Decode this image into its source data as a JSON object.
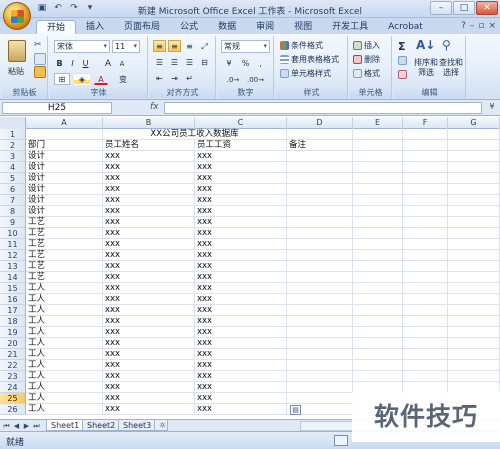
{
  "window": {
    "title": "新建 Microsoft Office Excel 工作表 - Microsoft Excel",
    "controls": [
      "–",
      "□",
      "✕"
    ]
  },
  "ribbon_tabs": [
    "开始",
    "插入",
    "页面布局",
    "公式",
    "数据",
    "审阅",
    "视图",
    "开发工具",
    "Acrobat"
  ],
  "ribbon": {
    "clipboard": {
      "paste": "粘贴",
      "label": "剪贴板"
    },
    "font": {
      "name": "宋体",
      "size": "11",
      "bold": "B",
      "italic": "I",
      "underline": "U",
      "grow": "A",
      "shrink": "A",
      "color_a": "A",
      "phonetic": "变",
      "label": "字体"
    },
    "alignment": {
      "label": "对齐方式"
    },
    "number": {
      "format": "常规",
      "label": "数字"
    },
    "styles": {
      "conditional": "条件格式",
      "table_format": "套用表格格式",
      "cell_styles": "单元格样式",
      "label": "样式"
    },
    "cells": {
      "insert": "插入",
      "delete": "删除",
      "format": "格式",
      "label": "单元格"
    },
    "editing": {
      "sum": "Σ",
      "sort": "排序和\n筛选",
      "find": "查找和\n选择",
      "label": "编辑"
    }
  },
  "formula_bar": {
    "name_box": "H25",
    "fx": "fx",
    "formula": ""
  },
  "columns": [
    "A",
    "B",
    "C",
    "D",
    "E",
    "F",
    "G"
  ],
  "rows": [
    {
      "n": "1",
      "a": "",
      "b": "",
      "c": "XX公司员工收入数据库",
      "d": ""
    },
    {
      "n": "2",
      "a": "部门",
      "b": "员工姓名",
      "c": "员工工资",
      "d": "备注"
    },
    {
      "n": "3",
      "a": "设计",
      "b": "xxx",
      "c": "xxx",
      "d": ""
    },
    {
      "n": "4",
      "a": "设计",
      "b": "xxx",
      "c": "xxx",
      "d": ""
    },
    {
      "n": "5",
      "a": "设计",
      "b": "xxx",
      "c": "xxx",
      "d": ""
    },
    {
      "n": "6",
      "a": "设计",
      "b": "xxx",
      "c": "xxx",
      "d": ""
    },
    {
      "n": "7",
      "a": "设计",
      "b": "xxx",
      "c": "xxx",
      "d": ""
    },
    {
      "n": "8",
      "a": "设计",
      "b": "xxx",
      "c": "xxx",
      "d": ""
    },
    {
      "n": "9",
      "a": "工艺",
      "b": "xxx",
      "c": "xxx",
      "d": ""
    },
    {
      "n": "10",
      "a": "工艺",
      "b": "xxx",
      "c": "xxx",
      "d": ""
    },
    {
      "n": "11",
      "a": "工艺",
      "b": "xxx",
      "c": "xxx",
      "d": ""
    },
    {
      "n": "12",
      "a": "工艺",
      "b": "xxx",
      "c": "xxx",
      "d": ""
    },
    {
      "n": "13",
      "a": "工艺",
      "b": "xxx",
      "c": "xxx",
      "d": ""
    },
    {
      "n": "14",
      "a": "工艺",
      "b": "xxx",
      "c": "xxx",
      "d": ""
    },
    {
      "n": "15",
      "a": "工人",
      "b": "xxx",
      "c": "xxx",
      "d": ""
    },
    {
      "n": "16",
      "a": "工人",
      "b": "xxx",
      "c": "xxx",
      "d": ""
    },
    {
      "n": "17",
      "a": "工人",
      "b": "xxx",
      "c": "xxx",
      "d": ""
    },
    {
      "n": "18",
      "a": "工人",
      "b": "xxx",
      "c": "xxx",
      "d": ""
    },
    {
      "n": "19",
      "a": "工人",
      "b": "xxx",
      "c": "xxx",
      "d": ""
    },
    {
      "n": "20",
      "a": "工人",
      "b": "xxx",
      "c": "xxx",
      "d": ""
    },
    {
      "n": "21",
      "a": "工人",
      "b": "xxx",
      "c": "xxx",
      "d": ""
    },
    {
      "n": "22",
      "a": "工人",
      "b": "xxx",
      "c": "xxx",
      "d": ""
    },
    {
      "n": "23",
      "a": "工人",
      "b": "xxx",
      "c": "xxx",
      "d": ""
    },
    {
      "n": "24",
      "a": "工人",
      "b": "xxx",
      "c": "xxx",
      "d": ""
    },
    {
      "n": "25",
      "a": "工人",
      "b": "xxx",
      "c": "xxx",
      "d": ""
    },
    {
      "n": "26",
      "a": "工人",
      "b": "xxx",
      "c": "xxx",
      "d": ""
    }
  ],
  "selected_row": "25",
  "sheets": [
    "Sheet1",
    "Sheet2",
    "Sheet3"
  ],
  "active_sheet": "Sheet1",
  "status": "就绪",
  "watermark": "软件技巧",
  "colors": {
    "accent": "#c9daf0",
    "selected": "#f5c866"
  }
}
